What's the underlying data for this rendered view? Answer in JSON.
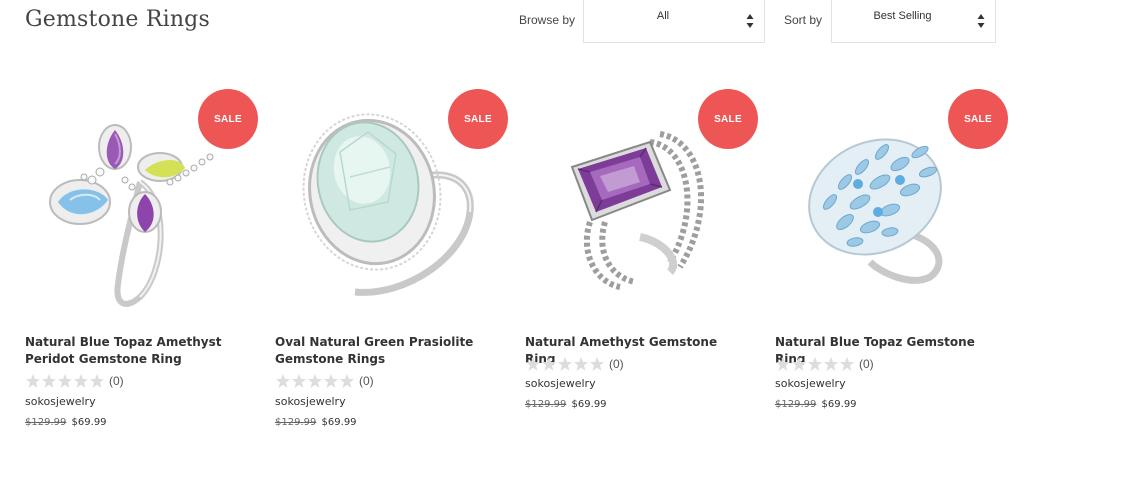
{
  "header": {
    "title": "Gemstone Rings",
    "browse_label": "Browse by",
    "browse_value": "All",
    "sort_label": "Sort by",
    "sort_value": "Best Selling"
  },
  "products": [
    {
      "name": "Natural Blue Topaz Amethyst Peridot Gemstone Ring",
      "badge": "SALE",
      "rating_count": "(0)",
      "vendor": "sokosjewelry",
      "price_old": "$129.99",
      "price_new": "$69.99",
      "image": "ring-blue-topaz-amethyst-peridot"
    },
    {
      "name": "Oval Natural Green Prasiolite Gemstone Rings",
      "badge": "SALE",
      "rating_count": "(0)",
      "vendor": "sokosjewelry",
      "price_old": "$129.99",
      "price_new": "$69.99",
      "image": "ring-green-prasiolite"
    },
    {
      "name": "Natural Amethyst Gemstone Ring",
      "badge": "SALE",
      "rating_count": "(0)",
      "vendor": "sokosjewelry",
      "price_old": "$129.99",
      "price_new": "$69.99",
      "image": "ring-amethyst"
    },
    {
      "name": "Natural Blue Topaz Gemstone Ring",
      "badge": "SALE",
      "rating_count": "(0)",
      "vendor": "sokosjewelry",
      "price_old": "$129.99",
      "price_new": "$69.99",
      "image": "ring-blue-topaz-cluster"
    }
  ],
  "colors": {
    "sale_badge": "#ee5656",
    "star_empty": "#dddddd",
    "border": "#e2e2e2"
  }
}
